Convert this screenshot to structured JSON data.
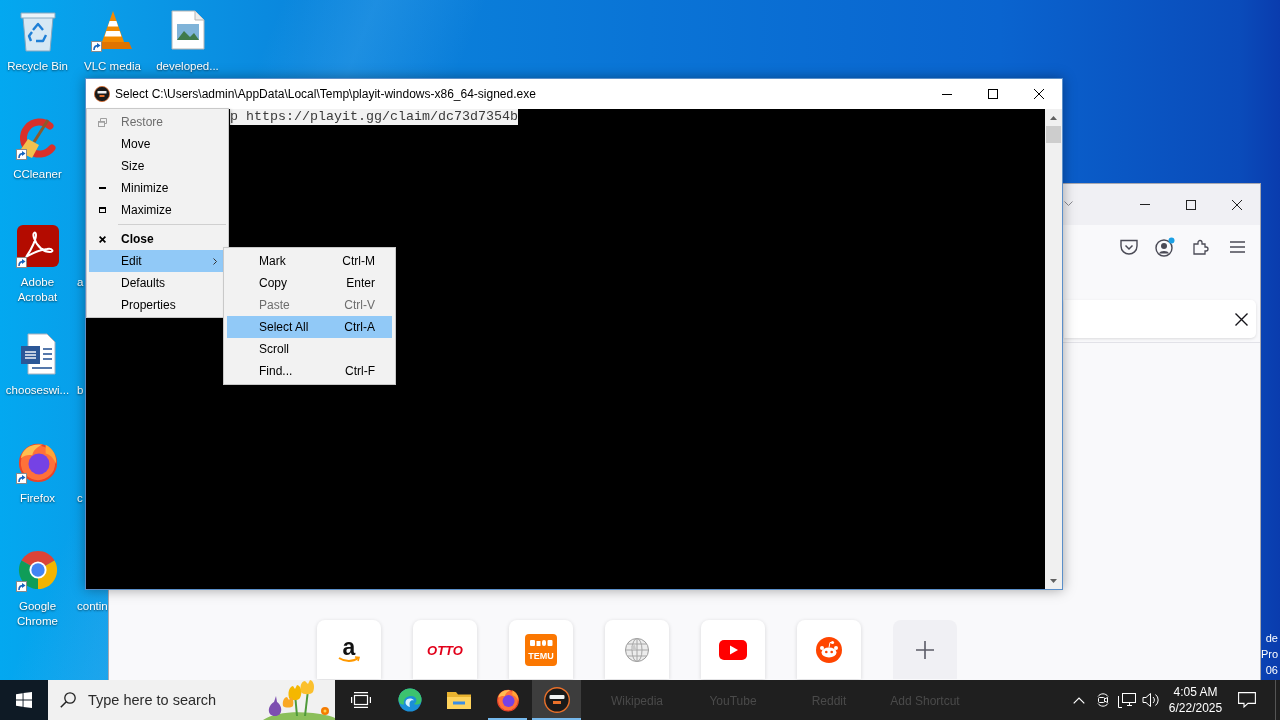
{
  "desktop": {
    "icon_rows": [
      [
        {
          "label": "Recycle Bin",
          "kind": "recycle-bin",
          "shortcut": false
        },
        {
          "label": "VLC media",
          "kind": "vlc",
          "shortcut": true
        },
        {
          "label": "developed...",
          "kind": "image-file",
          "shortcut": false
        }
      ],
      [
        {
          "label": "CCleaner",
          "kind": "ccleaner",
          "shortcut": true
        }
      ],
      [
        {
          "label": "Adobe Acrobat",
          "kind": "acrobat",
          "shortcut": true
        },
        {
          "label": "a"
        }
      ],
      [
        {
          "label": "chooseswi...",
          "kind": "word-document",
          "shortcut": false
        },
        {
          "label": "b"
        }
      ],
      [
        {
          "label": "Firefox",
          "kind": "firefox",
          "shortcut": true
        },
        {
          "label": "c"
        }
      ],
      [
        {
          "label": "Google Chrome",
          "kind": "chrome",
          "shortcut": true
        },
        {
          "label": "contin"
        }
      ]
    ],
    "corner_text": [
      "de",
      "Pro",
      "06"
    ]
  },
  "console_window": {
    "title": "Select C:\\Users\\admin\\AppData\\Local\\Temp\\playit-windows-x86_64-signed.exe",
    "lines": [
      {
        "text": "p https://playit.gg/claim/dc73d7354b",
        "selected": true
      }
    ]
  },
  "system_menu": {
    "sections": [
      {
        "items": [
          {
            "label": "Restore",
            "kind": "restore",
            "disabled": true,
            "default": false,
            "selected": false
          },
          {
            "label": "Move",
            "kind": "plain",
            "disabled": false,
            "default": false,
            "selected": false
          },
          {
            "label": "Size",
            "kind": "plain",
            "disabled": false,
            "default": false,
            "selected": false
          },
          {
            "label": "Minimize",
            "kind": "minimize",
            "disabled": false,
            "default": false,
            "selected": false
          },
          {
            "label": "Maximize",
            "kind": "maximize",
            "disabled": false,
            "default": false,
            "selected": false
          }
        ]
      },
      {
        "items": [
          {
            "label": "Close",
            "kind": "close",
            "disabled": false,
            "default": true,
            "selected": false
          },
          {
            "label": "Edit",
            "kind": "submenu",
            "disabled": false,
            "default": false,
            "selected": true
          },
          {
            "label": "Defaults",
            "kind": "plain",
            "disabled": false,
            "default": false,
            "selected": false
          },
          {
            "label": "Properties",
            "kind": "plain",
            "disabled": false,
            "default": false,
            "selected": false
          }
        ]
      }
    ],
    "submenu": {
      "items": [
        {
          "label": "Mark",
          "shortcut": "Ctrl-M",
          "disabled": false,
          "selected": false
        },
        {
          "label": "Copy",
          "shortcut": "Enter",
          "disabled": false,
          "selected": false
        },
        {
          "label": "Paste",
          "shortcut": "Ctrl-V",
          "disabled": true,
          "selected": false
        },
        {
          "label": "Select All",
          "shortcut": "Ctrl-A",
          "disabled": false,
          "selected": true
        },
        {
          "label": "Scroll",
          "disabled": false,
          "selected": false
        },
        {
          "label": "Find...",
          "shortcut": "Ctrl-F",
          "disabled": false,
          "selected": false
        }
      ]
    }
  },
  "browser": {
    "account_notification": true,
    "shortcuts": [
      {
        "kind": "amazon",
        "logo_text": "a"
      },
      {
        "kind": "otto",
        "logo_text": "OTTO"
      },
      {
        "kind": "temu",
        "logo_text": "TEMU"
      },
      {
        "kind": "wikipedia",
        "label": "Wikipedia"
      },
      {
        "kind": "youtube",
        "label": "YouTube"
      },
      {
        "kind": "reddit",
        "label": "Reddit"
      },
      {
        "kind": "add",
        "label": "Add Shortcut"
      }
    ]
  },
  "taskbar": {
    "search": {
      "placeholder": "Type here to search"
    },
    "apps": [
      {
        "kind": "task-view",
        "running": false,
        "active": false
      },
      {
        "kind": "edge",
        "running": false,
        "active": false
      },
      {
        "kind": "file-explorer",
        "running": false,
        "active": false
      },
      {
        "kind": "firefox",
        "running": true,
        "active": false
      },
      {
        "kind": "playit",
        "running": true,
        "active": true
      }
    ],
    "clock": {
      "time": "4:05 AM",
      "date": "6/22/2025"
    }
  }
}
